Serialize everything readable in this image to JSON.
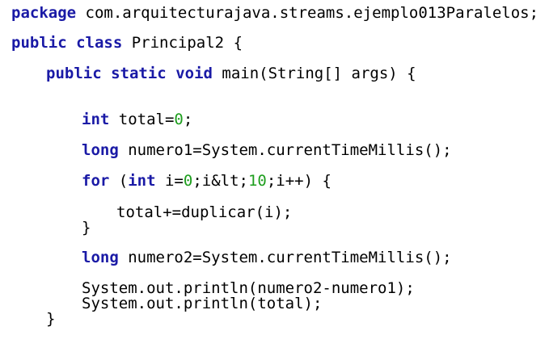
{
  "colors": {
    "background": "#ffffff",
    "text": "#000000",
    "keyword": "#1a1aa6",
    "number": "#1e9e1e"
  },
  "code": {
    "package_line": {
      "keyword": "package",
      "rest": " com.arquitecturajava.streams.ejemplo013Paralelos;"
    },
    "class_line": {
      "kw1": "public",
      "sp1": " ",
      "kw2": "class",
      "rest": " Principal2 {"
    },
    "main_line": {
      "kw1": "public",
      "sp1": " ",
      "kw2": "static",
      "sp2": " ",
      "kw3": "void",
      "rest": " main(String[] args) {"
    },
    "total_line": {
      "kw": "int",
      "mid": " total=",
      "num": "0",
      "end": ";"
    },
    "numero1_line": {
      "kw": "long",
      "rest": " numero1=System.currentTimeMillis();"
    },
    "for_line": {
      "kw1": "for",
      "p1": " (",
      "kw2": "int",
      "p2": " i=",
      "num1": "0",
      "p3": ";i&lt;",
      "num2": "10",
      "p4": ";i++) {"
    },
    "body_line": "total+=duplicar(i);",
    "for_close": "}",
    "numero2_line": {
      "kw": "long",
      "rest": " numero2=System.currentTimeMillis();"
    },
    "println1": "System.out.println(numero2-numero1);",
    "println2": "System.out.println(total);",
    "main_close": "}"
  }
}
